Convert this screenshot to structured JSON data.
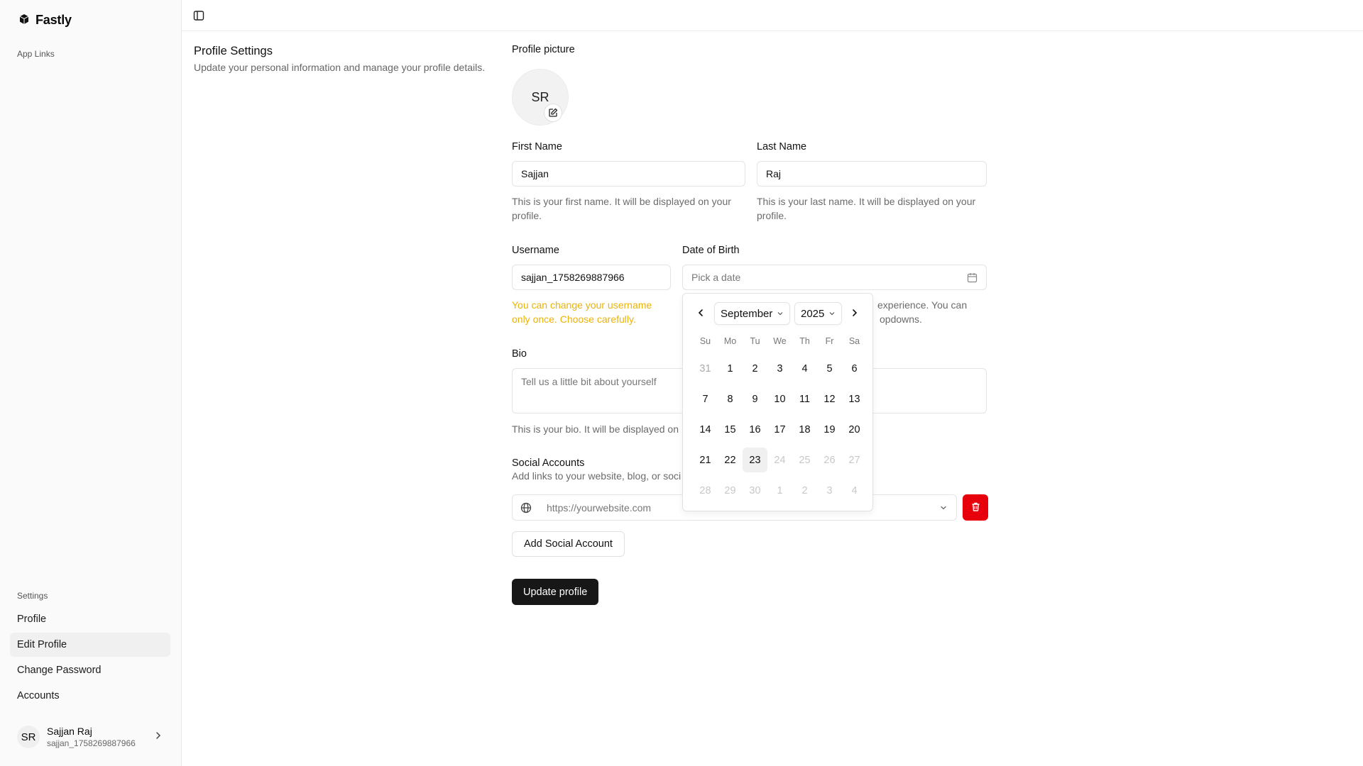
{
  "app": {
    "name": "Fastly"
  },
  "sidebar": {
    "group_app": "App Links",
    "group_settings": "Settings",
    "items": [
      {
        "label": "Profile",
        "active": false
      },
      {
        "label": "Edit Profile",
        "active": true
      },
      {
        "label": "Change Password",
        "active": false
      },
      {
        "label": "Accounts",
        "active": false
      }
    ],
    "user": {
      "initials": "SR",
      "name": "Sajjan Raj",
      "handle": "sajjan_1758269887966"
    }
  },
  "page": {
    "title": "Profile Settings",
    "subtitle": "Update your personal information and manage your profile details."
  },
  "form": {
    "picture_label": "Profile picture",
    "avatar_initials": "SR",
    "first_name": {
      "label": "First Name",
      "value": "Sajjan",
      "help": "This is your first name. It will be displayed on your profile."
    },
    "last_name": {
      "label": "Last Name",
      "value": "Raj",
      "help": "This is your last name. It will be displayed on your profile."
    },
    "username": {
      "label": "Username",
      "value": "sajjan_1758269887966",
      "help": "You can change your username only once. Choose carefully."
    },
    "dob": {
      "label": "Date of Birth",
      "placeholder": "Pick a date",
      "help_line1": "experience. You can",
      "help_line2": "opdowns."
    },
    "bio": {
      "label": "Bio",
      "placeholder": "Tell us a little bit about yourself",
      "help": "This is your bio. It will be displayed on"
    },
    "social": {
      "label": "Social Accounts",
      "help": "Add links to your website, blog, or soci",
      "url_placeholder": "https://yourwebsite.com",
      "add_label": "Add Social Account"
    },
    "submit_label": "Update profile"
  },
  "calendar": {
    "month": "September",
    "year": "2025",
    "weekdays": [
      "Su",
      "Mo",
      "Tu",
      "We",
      "Th",
      "Fr",
      "Sa"
    ],
    "weeks": [
      [
        {
          "d": "31",
          "s": "muted"
        },
        {
          "d": "1",
          "s": ""
        },
        {
          "d": "2",
          "s": ""
        },
        {
          "d": "3",
          "s": ""
        },
        {
          "d": "4",
          "s": ""
        },
        {
          "d": "5",
          "s": ""
        },
        {
          "d": "6",
          "s": ""
        }
      ],
      [
        {
          "d": "7",
          "s": ""
        },
        {
          "d": "8",
          "s": ""
        },
        {
          "d": "9",
          "s": ""
        },
        {
          "d": "10",
          "s": ""
        },
        {
          "d": "11",
          "s": ""
        },
        {
          "d": "12",
          "s": ""
        },
        {
          "d": "13",
          "s": ""
        }
      ],
      [
        {
          "d": "14",
          "s": ""
        },
        {
          "d": "15",
          "s": ""
        },
        {
          "d": "16",
          "s": ""
        },
        {
          "d": "17",
          "s": ""
        },
        {
          "d": "18",
          "s": ""
        },
        {
          "d": "19",
          "s": ""
        },
        {
          "d": "20",
          "s": ""
        }
      ],
      [
        {
          "d": "21",
          "s": ""
        },
        {
          "d": "22",
          "s": ""
        },
        {
          "d": "23",
          "s": "today"
        },
        {
          "d": "24",
          "s": "disabled"
        },
        {
          "d": "25",
          "s": "disabled"
        },
        {
          "d": "26",
          "s": "disabled"
        },
        {
          "d": "27",
          "s": "disabled"
        }
      ],
      [
        {
          "d": "28",
          "s": "disabled"
        },
        {
          "d": "29",
          "s": "disabled"
        },
        {
          "d": "30",
          "s": "disabled"
        },
        {
          "d": "1",
          "s": "disabled"
        },
        {
          "d": "2",
          "s": "disabled"
        },
        {
          "d": "3",
          "s": "disabled"
        },
        {
          "d": "4",
          "s": "disabled"
        }
      ]
    ]
  },
  "colors": {
    "danger": "#e7000b",
    "warning": "#eab308",
    "primary": "#171717"
  },
  "icons": [
    "cube-logo-icon",
    "sidebar-toggle-icon",
    "edit-icon",
    "calendar-icon",
    "chevron-left-icon",
    "chevron-right-icon",
    "chevron-down-icon",
    "globe-icon",
    "trash-icon"
  ]
}
